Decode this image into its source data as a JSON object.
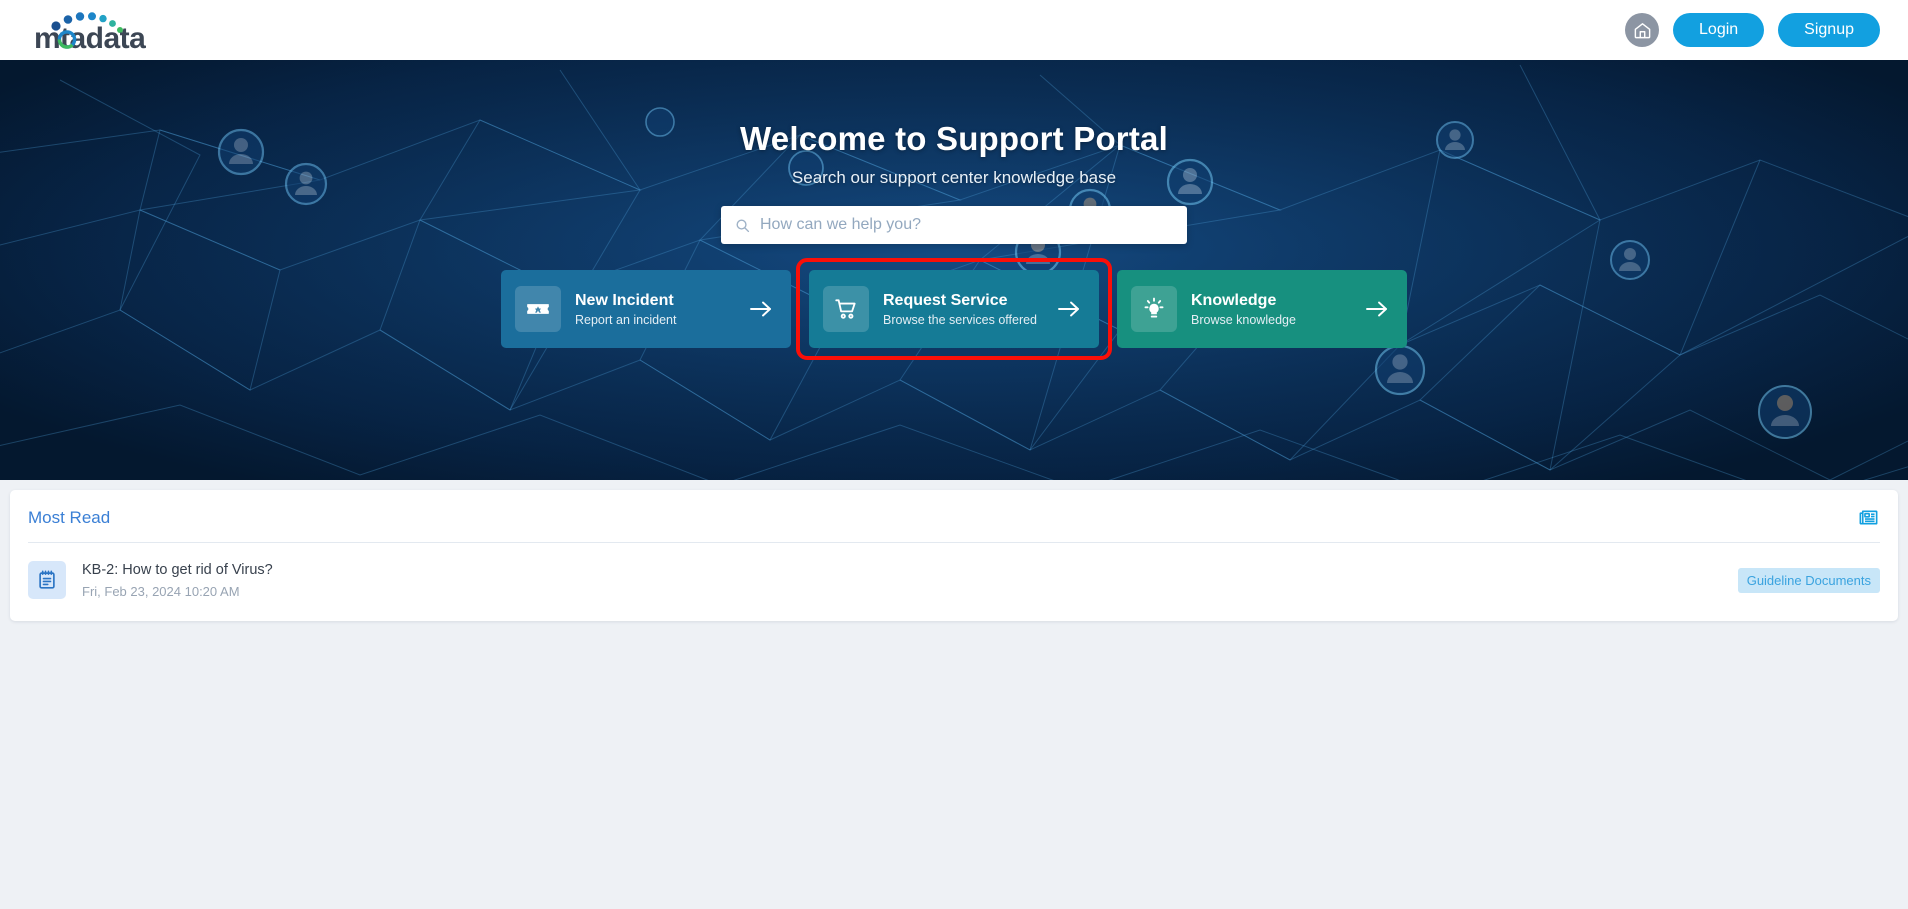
{
  "brand": {
    "name": "motadata",
    "logo_icon": "motadata-logo"
  },
  "header": {
    "home_icon": "home-icon",
    "login_label": "Login",
    "signup_label": "Signup"
  },
  "hero": {
    "title": "Welcome to Support Portal",
    "subtitle": "Search our support center knowledge base",
    "search": {
      "icon": "search-icon",
      "placeholder": "How can we help you?",
      "value": ""
    },
    "cards": [
      {
        "title": "New Incident",
        "subtitle": "Report an incident",
        "icon": "ticket-icon",
        "arrow_icon": "arrow-right-icon",
        "color": "#1b6e9c",
        "highlighted": false
      },
      {
        "title": "Request Service",
        "subtitle": "Browse the services offered",
        "icon": "shopping-cart-icon",
        "arrow_icon": "arrow-right-icon",
        "color": "#157b96",
        "highlighted": true,
        "highlight_color": "#fb0f08"
      },
      {
        "title": "Knowledge",
        "subtitle": "Browse knowledge",
        "icon": "lightbulb-icon",
        "arrow_icon": "arrow-right-icon",
        "color": "#17907f",
        "highlighted": false
      }
    ]
  },
  "most_read": {
    "title": "Most Read",
    "panel_icon": "newspaper-icon",
    "articles": [
      {
        "icon": "notepad-icon",
        "title": "KB-2: How to get rid of Virus?",
        "date": "Fri, Feb 23, 2024 10:20 AM",
        "tag": "Guideline Documents"
      }
    ]
  },
  "colors": {
    "accent_blue": "#12a0e0",
    "panel_title_blue": "#3a7fd5",
    "tag_bg": "#c8e6f8",
    "tag_text": "#3aa3df",
    "highlight_red": "#fb0f08"
  }
}
